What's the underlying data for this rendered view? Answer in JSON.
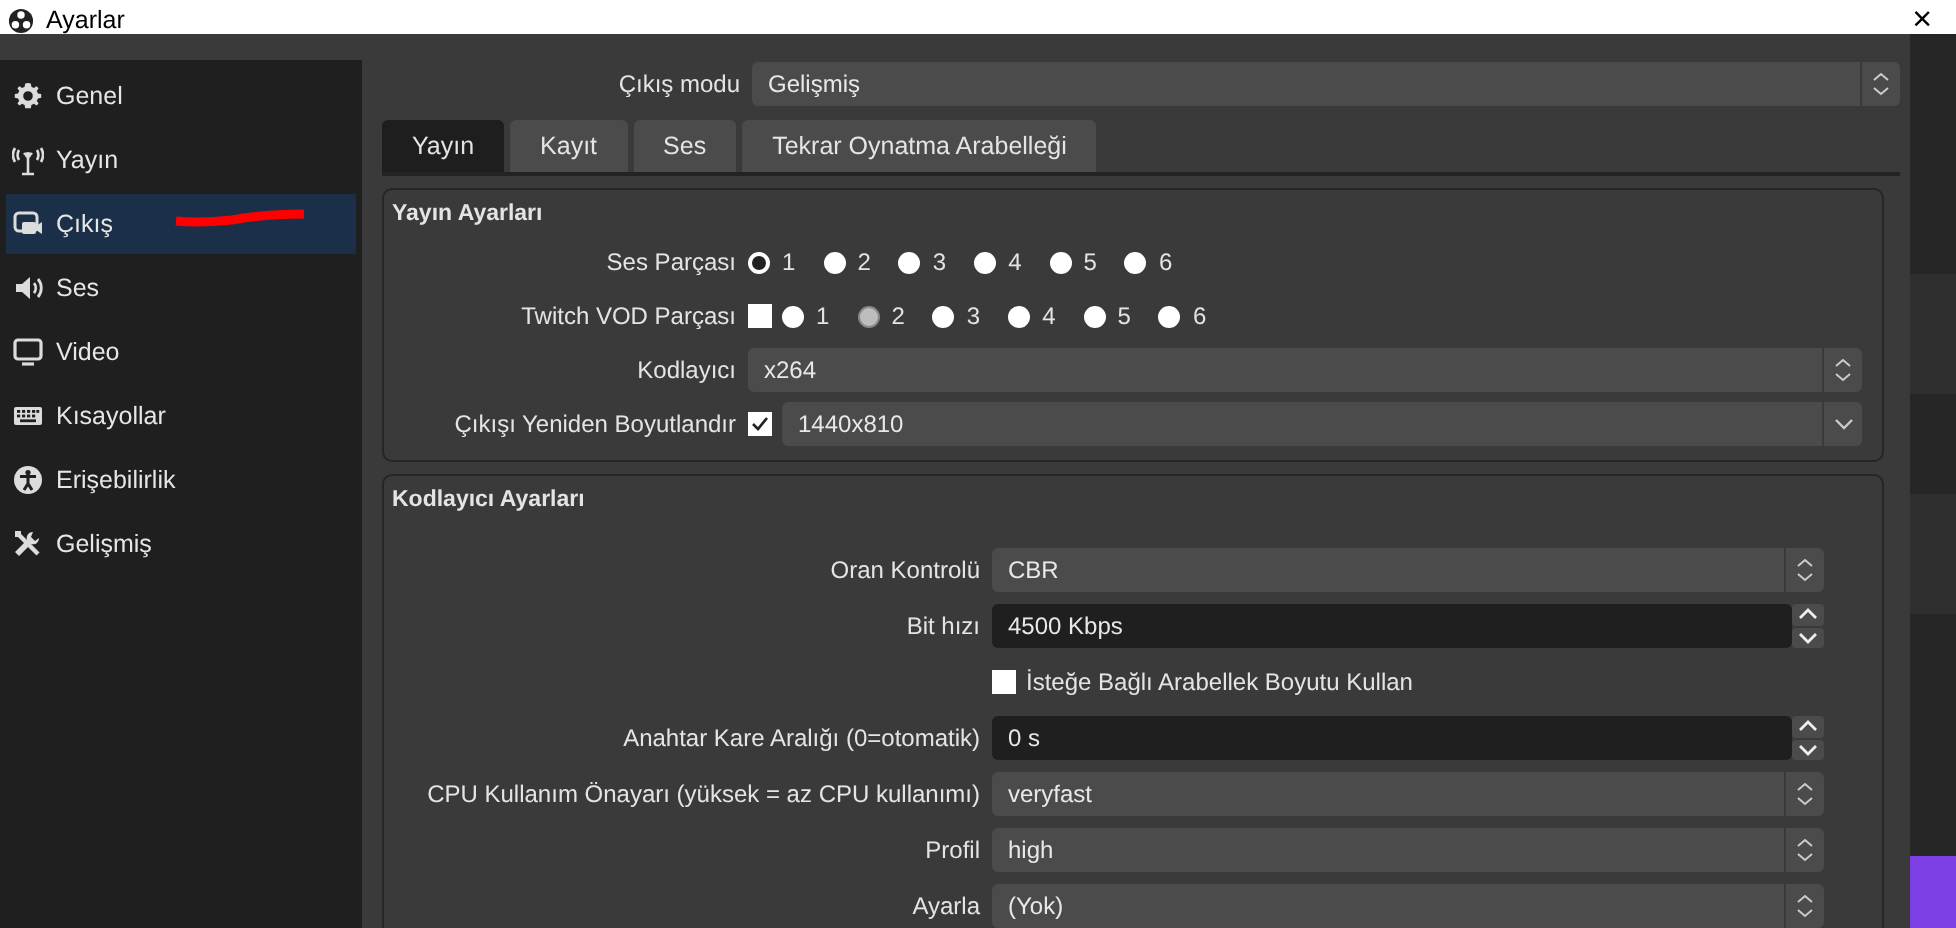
{
  "window": {
    "title": "Ayarlar",
    "close": "×"
  },
  "sidebar": {
    "items": [
      {
        "label": "Genel",
        "selected": false
      },
      {
        "label": "Yayın",
        "selected": false
      },
      {
        "label": "Çıkış",
        "selected": true
      },
      {
        "label": "Ses",
        "selected": false
      },
      {
        "label": "Video",
        "selected": false
      },
      {
        "label": "Kısayollar",
        "selected": false
      },
      {
        "label": "Erişebilirlik",
        "selected": false
      },
      {
        "label": "Gelişmiş",
        "selected": false
      }
    ]
  },
  "output_mode": {
    "label": "Çıkış modu",
    "value": "Gelişmiş"
  },
  "tabs": [
    {
      "label": "Yayın",
      "selected": true
    },
    {
      "label": "Kayıt",
      "selected": false
    },
    {
      "label": "Ses",
      "selected": false
    },
    {
      "label": "Tekrar Oynatma Arabelleği",
      "selected": false
    }
  ],
  "groups": [
    {
      "title": "Yayın Ayarları",
      "rows": [
        {
          "kind": "radios",
          "label": "Ses Parçası",
          "options": [
            {
              "label": "1",
              "selected": true,
              "disabled": false
            },
            {
              "label": "2",
              "selected": false,
              "disabled": false
            },
            {
              "label": "3",
              "selected": false,
              "disabled": false
            },
            {
              "label": "4",
              "selected": false,
              "disabled": false
            },
            {
              "label": "5",
              "selected": false,
              "disabled": false
            },
            {
              "label": "6",
              "selected": false,
              "disabled": false
            }
          ]
        },
        {
          "kind": "radios",
          "label": "Twitch VOD Parçası",
          "checked": false,
          "options": [
            {
              "label": "1",
              "selected": false,
              "disabled": false
            },
            {
              "label": "2",
              "selected": false,
              "disabled": true
            },
            {
              "label": "3",
              "selected": false,
              "disabled": false
            },
            {
              "label": "4",
              "selected": false,
              "disabled": false
            },
            {
              "label": "5",
              "selected": false,
              "disabled": false
            },
            {
              "label": "6",
              "selected": false,
              "disabled": false
            }
          ]
        },
        {
          "kind": "combo",
          "label": "Kodlayıcı",
          "value": "x264"
        },
        {
          "kind": "dropdown",
          "label": "Çıkışı Yeniden Boyutlandır",
          "checked": true,
          "value": "1440x810"
        }
      ]
    },
    {
      "title": "Kodlayıcı Ayarları",
      "rows": [
        {
          "kind": "combo",
          "label": "Oran Kontrolü",
          "value": "CBR"
        },
        {
          "kind": "spin",
          "label": "Bit hızı",
          "value": "4500 Kbps"
        },
        {
          "kind": "check",
          "text": "İsteğe Bağlı Arabellek Boyutu Kullan",
          "checked": false
        },
        {
          "kind": "spin",
          "label": "Anahtar Kare Aralığı (0=otomatik)",
          "value": "0 s"
        },
        {
          "kind": "combo",
          "label": "CPU Kullanım Önayarı (yüksek = az CPU kullanımı)",
          "value": "veryfast"
        },
        {
          "kind": "combo",
          "label": "Profil",
          "value": "high"
        },
        {
          "kind": "combo",
          "label": "Ayarla",
          "value": "(Yok)"
        }
      ]
    }
  ]
}
